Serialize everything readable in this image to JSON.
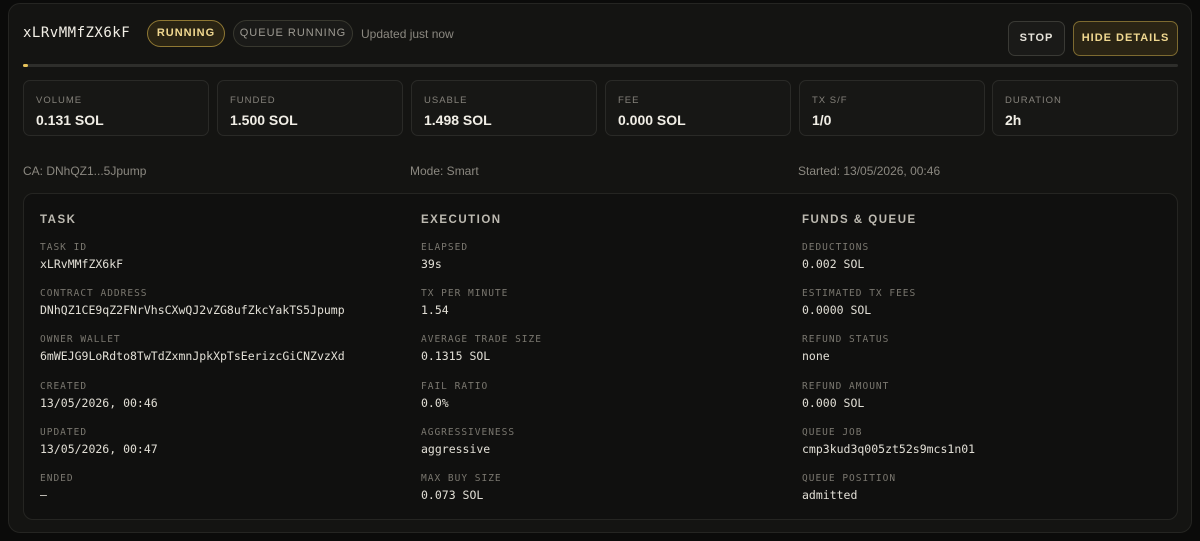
{
  "header": {
    "task_name": "xLRvMMfZX6kF",
    "status_badge": "RUNNING",
    "queue_badge": "QUEUE RUNNING",
    "updated_text": "Updated just now",
    "stop_label": "STOP",
    "hide_details_label": "HIDE DETAILS"
  },
  "progress": {
    "fraction": 0.004,
    "color": "#e6c25a"
  },
  "stats": [
    {
      "label": "VOLUME",
      "value": "0.131 SOL"
    },
    {
      "label": "FUNDED",
      "value": "1.500 SOL"
    },
    {
      "label": "USABLE",
      "value": "1.498 SOL"
    },
    {
      "label": "FEE",
      "value": "0.000 SOL"
    },
    {
      "label": "TX S/F",
      "value": "1/0"
    },
    {
      "label": "DURATION",
      "value": "2h"
    }
  ],
  "meta": {
    "ca": "CA: DNhQZ1...5Jpump",
    "mode": "Mode: Smart",
    "started": "Started: 13/05/2026, 00:46"
  },
  "details": {
    "task": {
      "heading": "TASK",
      "fields": [
        {
          "label": "TASK ID",
          "value": "xLRvMMfZX6kF"
        },
        {
          "label": "CONTRACT ADDRESS",
          "value": "DNhQZ1CE9qZ2FNrVhsCXwQJ2vZG8ufZkcYakTS5Jpump"
        },
        {
          "label": "OWNER WALLET",
          "value": "6mWEJG9LoRdto8TwTdZxmnJpkXpTsEerizcGiCNZvzXd"
        },
        {
          "label": "CREATED",
          "value": "13/05/2026, 00:46"
        },
        {
          "label": "UPDATED",
          "value": "13/05/2026, 00:47"
        },
        {
          "label": "ENDED",
          "value": "—"
        }
      ]
    },
    "execution": {
      "heading": "EXECUTION",
      "fields": [
        {
          "label": "ELAPSED",
          "value": "39s"
        },
        {
          "label": "TX PER MINUTE",
          "value": "1.54"
        },
        {
          "label": "AVERAGE TRADE SIZE",
          "value": "0.1315 SOL"
        },
        {
          "label": "FAIL RATIO",
          "value": "0.0%"
        },
        {
          "label": "AGGRESSIVENESS",
          "value": "aggressive"
        },
        {
          "label": "MAX BUY SIZE",
          "value": "0.073 SOL"
        }
      ]
    },
    "funds_queue": {
      "heading": "FUNDS & QUEUE",
      "fields": [
        {
          "label": "DEDUCTIONS",
          "value": "0.002 SOL"
        },
        {
          "label": "ESTIMATED TX FEES",
          "value": "0.0000 SOL"
        },
        {
          "label": "REFUND STATUS",
          "value": "none"
        },
        {
          "label": "REFUND AMOUNT",
          "value": "0.000 SOL"
        },
        {
          "label": "QUEUE JOB",
          "value": "cmp3kud3q005zt52s9mcs1n01"
        },
        {
          "label": "QUEUE POSITION",
          "value": "admitted"
        }
      ]
    }
  }
}
